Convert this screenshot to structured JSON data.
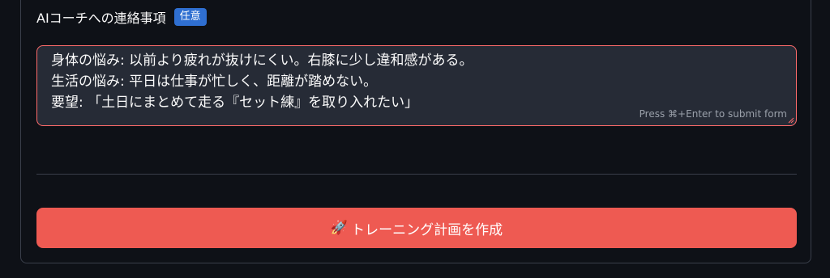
{
  "field": {
    "label": "AIコーチへの連絡事項",
    "badge": "任意"
  },
  "textarea": {
    "lines": [
      "身体の悩み: 以前より疲れが抜けにくい。右膝に少し違和感がある。",
      "生活の悩み: 平日は仕事が忙しく、距離が踏めない。",
      "要望: 「土日にまとめて走る『セット練』を取り入れたい」"
    ],
    "hint": "Press ⌘+Enter to submit form"
  },
  "submit": {
    "icon": "rocket-icon",
    "emoji": "🚀",
    "label": "トレーニング計画を作成"
  },
  "colors": {
    "background": "#0e1117",
    "textarea_bg": "#262b36",
    "textarea_border": "#ff6b6b",
    "badge": "#2f6fd1",
    "button": "#ee5a52"
  }
}
